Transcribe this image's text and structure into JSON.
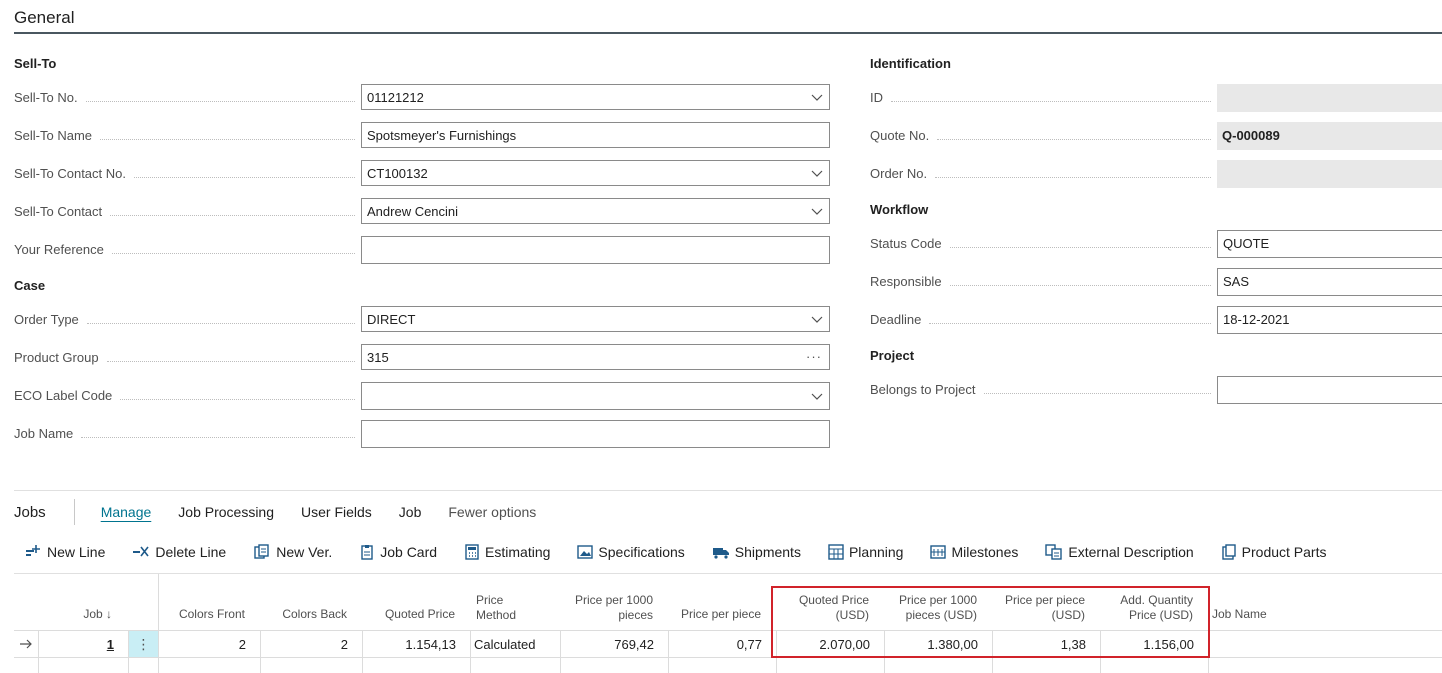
{
  "section": {
    "title": "General"
  },
  "sell_to": {
    "group": "Sell-To",
    "no": {
      "label": "Sell-To No.",
      "value": "01121212"
    },
    "name": {
      "label": "Sell-To Name",
      "value": "Spotsmeyer's Furnishings"
    },
    "contact_no": {
      "label": "Sell-To Contact No.",
      "value": "CT100132"
    },
    "contact": {
      "label": "Sell-To Contact",
      "value": "Andrew Cencini"
    },
    "your_reference": {
      "label": "Your Reference",
      "value": ""
    }
  },
  "case": {
    "group": "Case",
    "order_type": {
      "label": "Order Type",
      "value": "DIRECT"
    },
    "product_group": {
      "label": "Product Group",
      "value": "315"
    },
    "eco_label": {
      "label": "ECO Label Code",
      "value": ""
    },
    "job_name": {
      "label": "Job Name",
      "value": ""
    }
  },
  "identification": {
    "group": "Identification",
    "id": {
      "label": "ID",
      "value": ""
    },
    "quote_no": {
      "label": "Quote No.",
      "value": "Q-000089"
    },
    "order_no": {
      "label": "Order No.",
      "value": ""
    }
  },
  "workflow": {
    "group": "Workflow",
    "status_code": {
      "label": "Status Code",
      "value": "QUOTE"
    },
    "responsible": {
      "label": "Responsible",
      "value": "SAS"
    },
    "deadline": {
      "label": "Deadline",
      "value": "18-12-2021"
    }
  },
  "project": {
    "group": "Project",
    "belongs_to": {
      "label": "Belongs to Project",
      "value": ""
    }
  },
  "jobs": {
    "title": "Jobs",
    "tabs": [
      "Manage",
      "Job Processing",
      "User Fields",
      "Job",
      "Fewer options"
    ],
    "actions": [
      "New Line",
      "Delete Line",
      "New Ver.",
      "Job Card",
      "Estimating",
      "Specifications",
      "Shipments",
      "Planning",
      "Milestones",
      "External Description",
      "Product Parts"
    ],
    "columns": {
      "job": "Job ↓",
      "colors_front": "Colors Front",
      "colors_back": "Colors Back",
      "quoted_price": "Quoted Price",
      "price_method_1": "Price",
      "price_method_2": "Method",
      "price_per_1000_1": "Price per 1000",
      "price_per_1000_2": "pieces",
      "price_per_piece": "Price per piece",
      "quoted_price_usd_1": "Quoted Price",
      "quoted_price_usd_2": "(USD)",
      "price_per_1000_usd_1": "Price per 1000",
      "price_per_1000_usd_2": "pieces (USD)",
      "price_per_piece_usd_1": "Price per piece",
      "price_per_piece_usd_2": "(USD)",
      "add_qty_usd_1": "Add. Quantity",
      "add_qty_usd_2": "Price (USD)",
      "job_name": "Job Name"
    },
    "rows": [
      {
        "job": "1",
        "colors_front": "2",
        "colors_back": "2",
        "quoted_price": "1.154,13",
        "price_method": "Calculated",
        "price_per_1000": "769,42",
        "price_per_piece": "0,77",
        "quoted_price_usd": "2.070,00",
        "price_per_1000_usd": "1.380,00",
        "price_per_piece_usd": "1,38",
        "add_qty_usd": "1.156,00",
        "job_name": ""
      }
    ]
  },
  "colors": {
    "accent": "#00748f",
    "highlight": "#d1232a",
    "selected_cell": "#c9eef5"
  }
}
